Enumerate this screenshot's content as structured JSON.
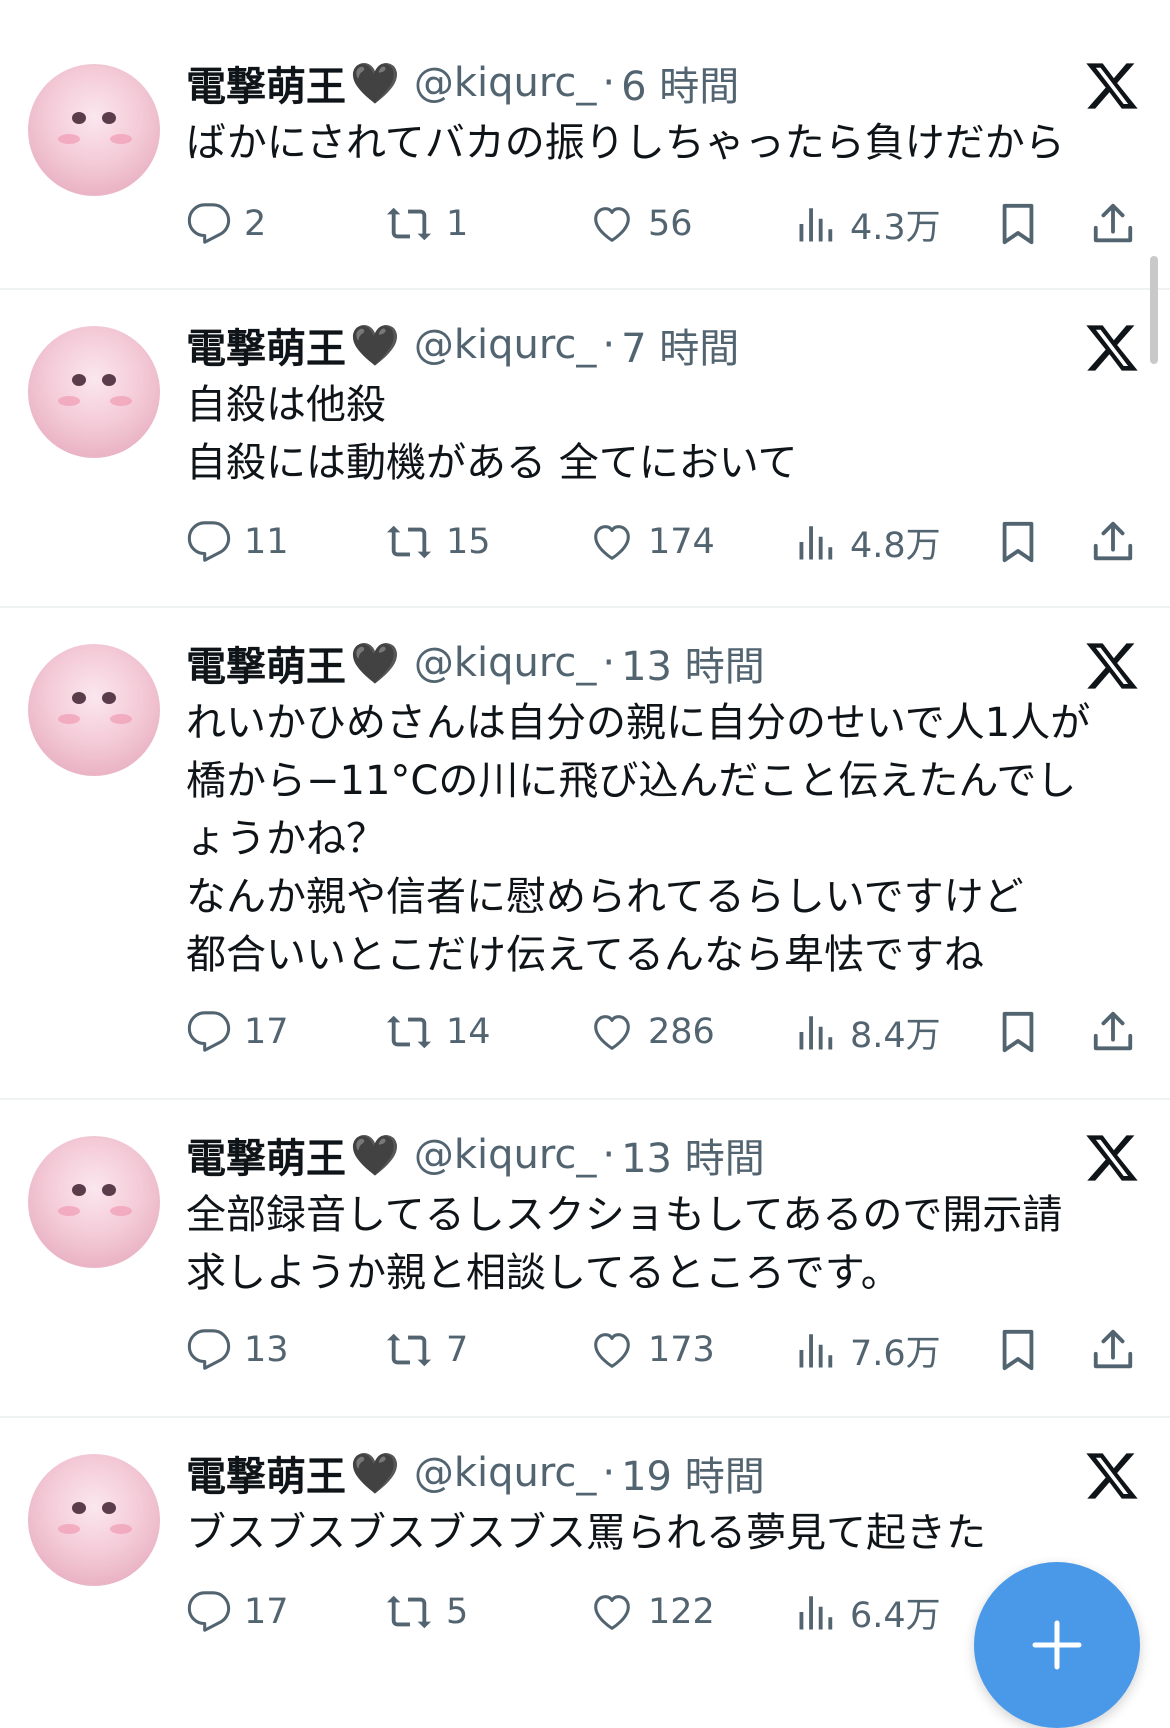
{
  "icons": {
    "reply": "reply-icon",
    "retweet": "retweet-icon",
    "like": "heart-icon",
    "views": "views-chart-icon",
    "bookmark": "bookmark-icon",
    "share": "share-icon",
    "platform": "x-logo-icon",
    "compose": "plus-icon"
  },
  "colors": {
    "accent": "#4a99e9",
    "secondary_text": "#536471",
    "divider": "#eff3f4"
  },
  "tweets": [
    {
      "author": "電撃萌王",
      "author_emoji": "🖤",
      "handle": "@kiqurc_",
      "sep": "·",
      "time": "6 時間",
      "lines": [
        "ばかにされてバカの振りしちゃったら負けだから"
      ],
      "replies": "2",
      "retweets": "1",
      "likes": "56",
      "views": "4.3万"
    },
    {
      "author": "電撃萌王",
      "author_emoji": "🖤",
      "handle": "@kiqurc_",
      "sep": "·",
      "time": "7 時間",
      "lines": [
        "自殺は他殺",
        "自殺には動機がある 全てにおいて"
      ],
      "replies": "11",
      "retweets": "15",
      "likes": "174",
      "views": "4.8万"
    },
    {
      "author": "電撃萌王",
      "author_emoji": "🖤",
      "handle": "@kiqurc_",
      "sep": "·",
      "time": "13 時間",
      "lines": [
        "れいかひめさんは自分の親に自分のせいで人1人が",
        "橋から−11°Cの川に飛び込んだこと伝えたんでし",
        "ょうかね？",
        "なんか親や信者に慰められてるらしいですけど",
        "都合いいとこだけ伝えてるんなら卑怯ですね"
      ],
      "replies": "17",
      "retweets": "14",
      "likes": "286",
      "views": "8.4万"
    },
    {
      "author": "電撃萌王",
      "author_emoji": "🖤",
      "handle": "@kiqurc_",
      "sep": "·",
      "time": "13 時間",
      "lines": [
        "全部録音してるしスクショもしてあるので開示請",
        "求しようか親と相談してるところです。"
      ],
      "replies": "13",
      "retweets": "7",
      "likes": "173",
      "views": "7.6万"
    },
    {
      "author": "電撃萌王",
      "author_emoji": "🖤",
      "handle": "@kiqurc_",
      "sep": "·",
      "time": "19 時間",
      "lines": [
        "ブスブスブスブスブス罵られる夢見て起きた"
      ],
      "replies": "17",
      "retweets": "5",
      "likes": "122",
      "views": "6.4万"
    }
  ]
}
